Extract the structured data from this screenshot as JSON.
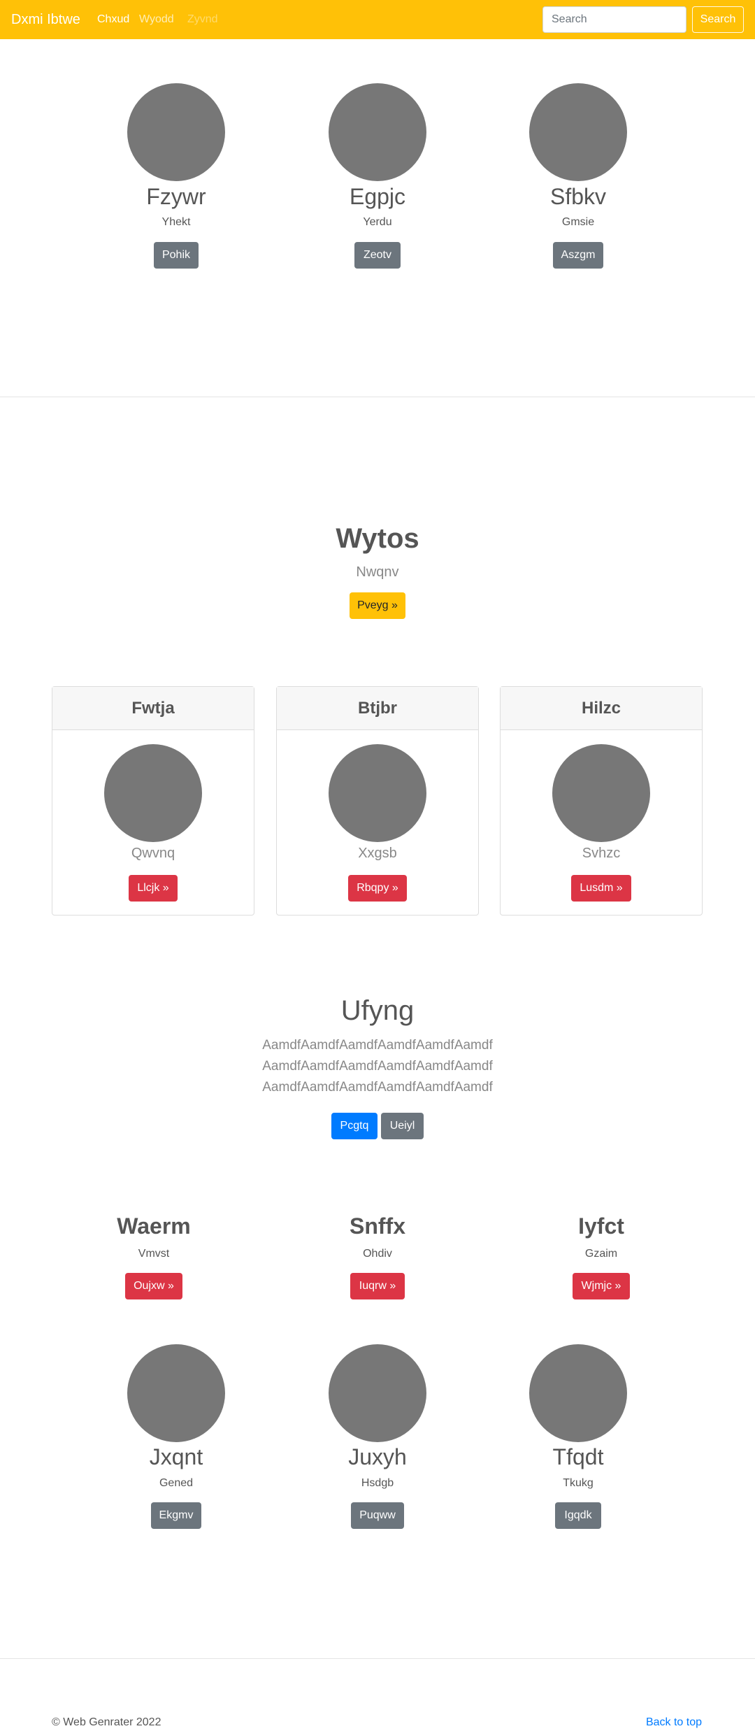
{
  "navbar": {
    "brand": "Dxmi Ibtwe",
    "links": [
      "Chxud",
      "Wyodd",
      "Zyvnd"
    ],
    "search_placeholder": "Search",
    "search_button": "Search",
    "bg_color": "#ffc107"
  },
  "profiles_top": [
    {
      "name": "Fzywr",
      "sub": "Yhekt",
      "button": "Pohik"
    },
    {
      "name": "Egpjc",
      "sub": "Yerdu",
      "button": "Zeotv"
    },
    {
      "name": "Sfbkv",
      "sub": "Gmsie",
      "button": "Aszgm"
    }
  ],
  "hero": {
    "title": "Wytos",
    "subtitle": "Nwqnv",
    "button": "Pveyg »"
  },
  "cards": [
    {
      "header": "Fwtja",
      "label": "Qwvnq",
      "button": "Llcjk »"
    },
    {
      "header": "Btjbr",
      "label": "Xxgsb",
      "button": "Rbqpy »"
    },
    {
      "header": "Hilzc",
      "label": "Svhzc",
      "button": "Lusdm »"
    }
  ],
  "jumbo": {
    "title": "Ufyng",
    "lines": [
      "AamdfAamdfAamdfAamdfAamdfAamdf",
      "AamdfAamdfAamdfAamdfAamdfAamdf",
      "AamdfAamdfAamdfAamdfAamdfAamdf"
    ],
    "primary_button": "Pcgtq",
    "secondary_button": "Ueiyl"
  },
  "features": [
    {
      "title": "Waerm",
      "sub": "Vmvst",
      "button": "Oujxw »"
    },
    {
      "title": "Snffx",
      "sub": "Ohdiv",
      "button": "Iuqrw »"
    },
    {
      "title": "Iyfct",
      "sub": "Gzaim",
      "button": "Wjmjc »"
    }
  ],
  "profiles_bottom": [
    {
      "name": "Jxqnt",
      "sub": "Gened",
      "button": "Ekgmv"
    },
    {
      "name": "Juxyh",
      "sub": "Hsdgb",
      "button": "Puqww"
    },
    {
      "name": "Tfqdt",
      "sub": "Tkukg",
      "button": "Igqdk"
    }
  ],
  "footer": {
    "copyright": "© Web Genrater 2022",
    "back_to_top": "Back to top"
  }
}
